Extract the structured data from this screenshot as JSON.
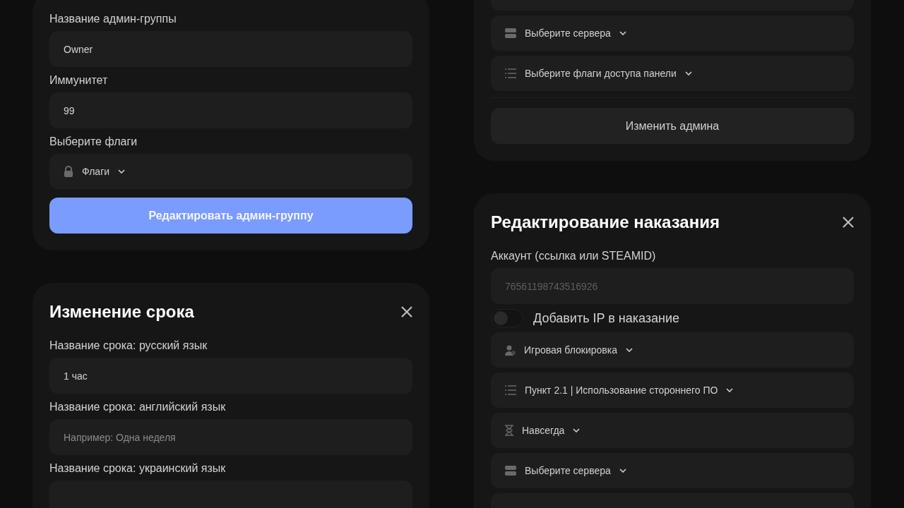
{
  "columns": [
    {
      "cards": [
        {
          "items": [
            {
              "kind": "label",
              "text": "Название админ-группы"
            },
            {
              "kind": "input",
              "value": "Owner"
            },
            {
              "kind": "label",
              "text": "Иммунитет"
            },
            {
              "kind": "input",
              "value": "99"
            },
            {
              "kind": "label",
              "text": "Выберите флаги"
            },
            {
              "kind": "lock-select",
              "text": "Флаги"
            },
            {
              "kind": "button",
              "primary": true,
              "text": "Редактировать админ-группу"
            }
          ]
        },
        {
          "title": "Изменение срока",
          "items": [
            {
              "kind": "label",
              "text": "Название срока: русский язык"
            },
            {
              "kind": "input",
              "value": "1 час"
            },
            {
              "kind": "label",
              "text": "Название срока: английский язык"
            },
            {
              "kind": "input",
              "placeholder": "Например: Одна неделя"
            },
            {
              "kind": "label",
              "text": "Название срока: украинский язык"
            },
            {
              "kind": "input"
            }
          ]
        }
      ]
    },
    {
      "cards": [
        {
          "items": [
            {
              "kind": "input"
            },
            {
              "kind": "server-select",
              "text": "Выберите сервера"
            },
            {
              "kind": "list-select",
              "text": "Выберите флаги доступа панели"
            },
            {
              "kind": "divider"
            },
            {
              "kind": "button",
              "primary": false,
              "text": "Изменить админа"
            }
          ]
        },
        {
          "title": "Редактирование наказания",
          "items": [
            {
              "kind": "label",
              "text": "Аккаунт (ссылка или STEAMID)"
            },
            {
              "kind": "input",
              "placeholder": "76561198743516926",
              "disabled": true
            },
            {
              "kind": "toggle",
              "on": false,
              "text": "Добавить IP в наказание"
            },
            {
              "kind": "user-select",
              "text": "Игровая блокировка"
            },
            {
              "kind": "list-select",
              "text": "Пункт 2.1 | Использование стороннего ПО"
            },
            {
              "kind": "time-select",
              "text": "Навсегда"
            },
            {
              "kind": "server-select",
              "text": "Выберите сервера"
            },
            {
              "kind": "select"
            }
          ]
        }
      ]
    }
  ]
}
